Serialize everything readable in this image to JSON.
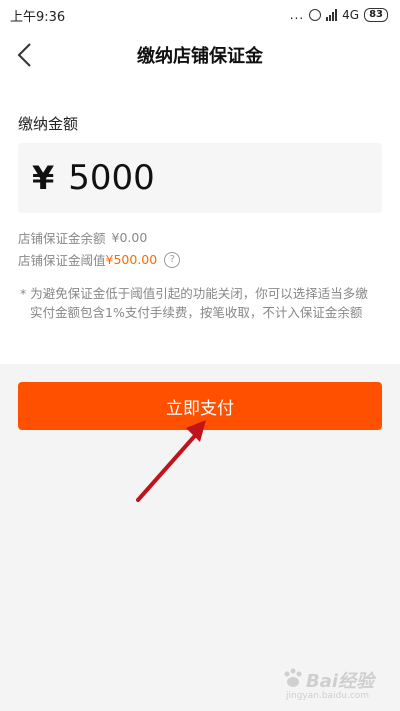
{
  "status_bar": {
    "time": "上午9:36",
    "dots": "...",
    "network": "4G",
    "battery": "83"
  },
  "header": {
    "title": "缴纳店铺保证金"
  },
  "amount": {
    "label": "缴纳金额",
    "currency": "¥",
    "value": "5000"
  },
  "info": {
    "balance_label": "店铺保证金余额",
    "balance_value": "¥0.00",
    "threshold_label": "店铺保证金阈值",
    "threshold_value": "¥500.00",
    "help": "?"
  },
  "note": {
    "line1": "* 为避免保证金低于阈值引起的功能关闭，你可以选择适当多缴",
    "line2": "实付金额包含1%支付手续费，按笔收取，不计入保证金余额"
  },
  "pay_button": {
    "label": "立即支付"
  },
  "watermark": {
    "brand": "Bai经验",
    "sub": "jingyan.baidu.com"
  },
  "colors": {
    "accent": "#ff5000",
    "highlight": "#ff6a00",
    "arrow": "#c0131b"
  }
}
